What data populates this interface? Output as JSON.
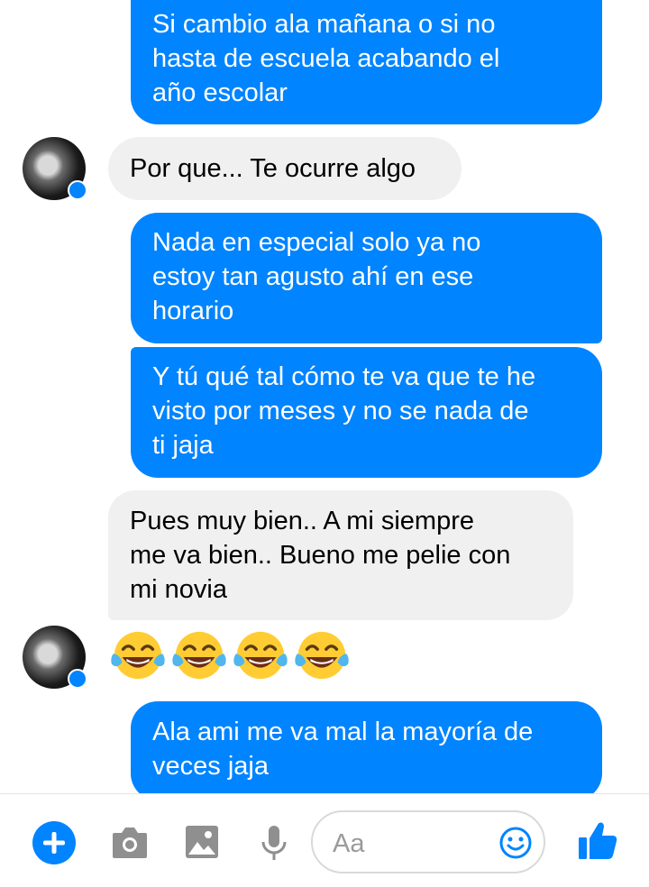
{
  "messages": [
    {
      "side": "out",
      "text": "Si cambio ala mañana o si no\nhasta de escuela acabando el\naño escolar"
    },
    {
      "side": "in",
      "text": "Por que... Te ocurre algo"
    },
    {
      "side": "out",
      "text": "Nada en especial solo ya no\nestoy tan agusto ahí en ese\nhorario"
    },
    {
      "side": "out",
      "text": "Y tú qué tal cómo te va que te he\nvisto por meses y no se nada de\nti jaja"
    },
    {
      "side": "in",
      "text": "Pues muy bien.. A mi siempre\nme va bien.. Bueno me pelie con\nmi novia"
    },
    {
      "side": "in",
      "emoji": "tears-of-joy",
      "count": 4
    },
    {
      "side": "out",
      "text": "Ala ami me va mal la mayoría de\nveces jaja"
    }
  ],
  "composer": {
    "placeholder": "Aa",
    "icons": [
      "plus-icon",
      "camera-icon",
      "image-icon",
      "microphone-icon",
      "smiley-icon",
      "thumbs-up-icon"
    ]
  },
  "colors": {
    "outgoing": "#0084ff",
    "incoming": "#f1f0f0",
    "accent": "#0084ff"
  }
}
